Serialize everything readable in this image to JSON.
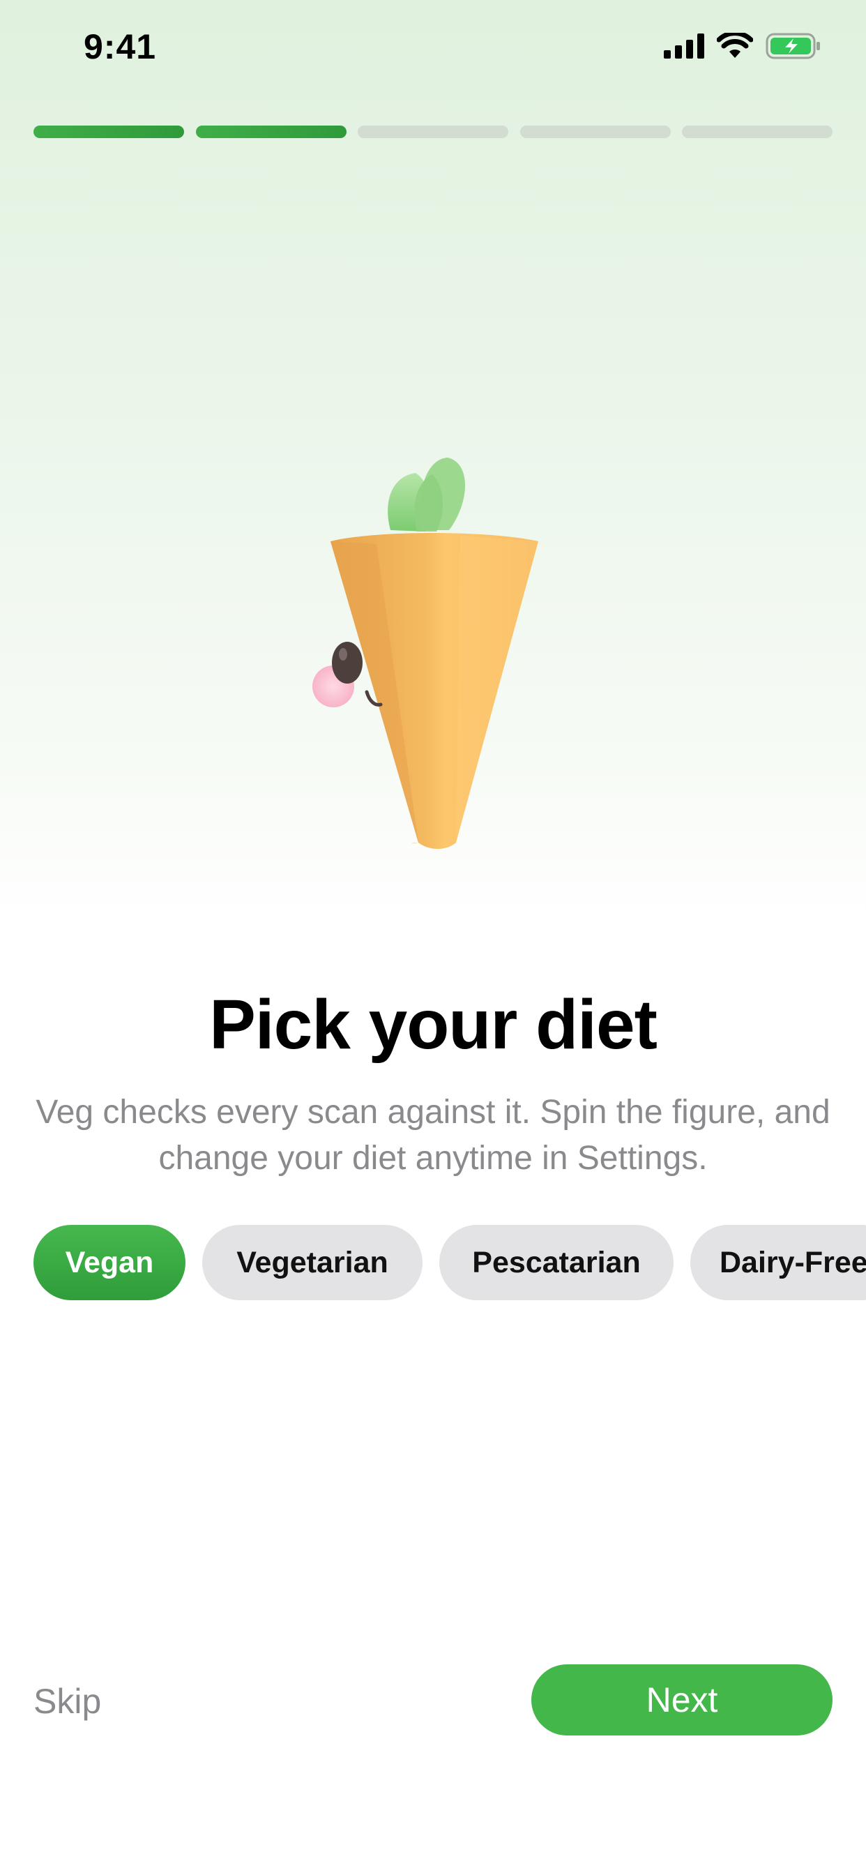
{
  "status_bar": {
    "time": "9:41",
    "icons": [
      "cellular-signal-icon",
      "wifi-icon",
      "battery-charging-icon"
    ],
    "battery_color": "#34c759"
  },
  "progress": {
    "total_steps": 5,
    "completed_steps": 2,
    "active_color": "#2f9a3a",
    "inactive_color": "#d2dcd0"
  },
  "hero": {
    "figure": "carrot-character-3d",
    "rotatable": true
  },
  "header": {
    "title": "Pick your diet",
    "subtitle": "Veg checks every scan against it. Spin the figure, and change your diet anytime in Settings."
  },
  "diet_options": [
    {
      "label": "Vegan",
      "selected": true
    },
    {
      "label": "Vegetarian",
      "selected": false
    },
    {
      "label": "Pescatarian",
      "selected": false
    },
    {
      "label": "Dairy-Free",
      "selected": false
    }
  ],
  "actions": {
    "skip_label": "Skip",
    "next_label": "Next",
    "accent_color": "#44b74b"
  }
}
